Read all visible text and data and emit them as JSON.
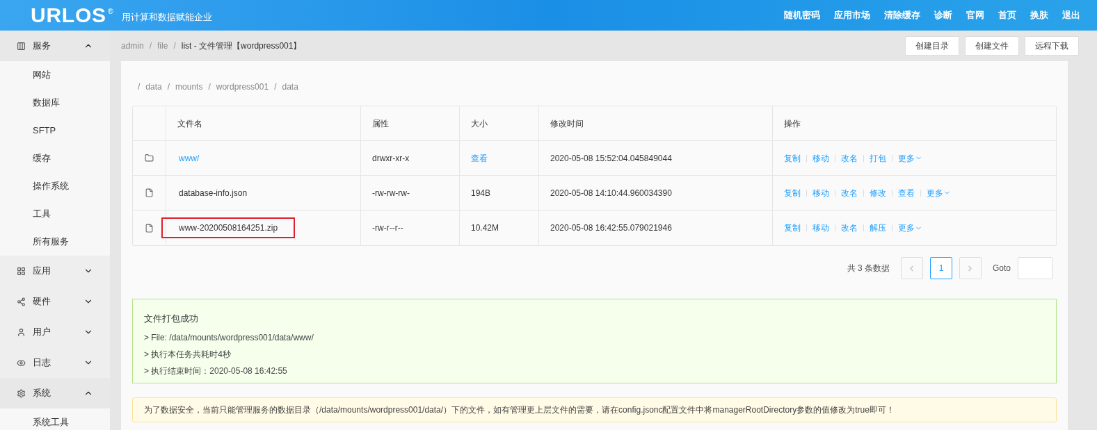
{
  "header": {
    "logo": "URLOS",
    "logo_mark": "®",
    "tagline": "用计算和数据赋能企业",
    "nav": [
      "随机密码",
      "应用市场",
      "清除缓存",
      "诊断",
      "官网",
      "首页",
      "换肤",
      "退出"
    ]
  },
  "sidebar": {
    "groups": [
      {
        "label": "服务",
        "expanded": true,
        "children": [
          {
            "label": "网站"
          },
          {
            "label": "数据库"
          },
          {
            "label": "SFTP"
          },
          {
            "label": "缓存"
          },
          {
            "label": "操作系统"
          },
          {
            "label": "工具"
          },
          {
            "label": "所有服务"
          }
        ]
      },
      {
        "label": "应用",
        "expanded": false
      },
      {
        "label": "硬件",
        "expanded": false
      },
      {
        "label": "用户",
        "expanded": false
      },
      {
        "label": "日志",
        "expanded": false
      },
      {
        "label": "系统",
        "expanded": true,
        "children": [
          {
            "label": "系统工具"
          }
        ]
      }
    ]
  },
  "breadcrumb_separator": "/",
  "breadcrumb": [
    "admin",
    "file",
    "list - 文件管理【wordpress001】"
  ],
  "toolbar": [
    "创建目录",
    "创建文件",
    "远程下载"
  ],
  "path_separator": "/",
  "path": [
    "data",
    "mounts",
    "wordpress001",
    "data"
  ],
  "table": {
    "columns": [
      "",
      "文件名",
      "属性",
      "大小",
      "修改时间",
      "操作"
    ],
    "rows": [
      {
        "kind": "folder",
        "name": "www/",
        "highlighted": false,
        "attributes": "drwxr-xr-x",
        "size": "查看",
        "size_link": true,
        "modified": "2020-05-08 15:52:04.045849044",
        "actions": [
          {
            "label": "复制",
            "kind": "link"
          },
          {
            "label": "移动",
            "kind": "link"
          },
          {
            "label": "改名",
            "kind": "link"
          },
          {
            "label": "打包",
            "kind": "link"
          },
          {
            "label": "更多",
            "kind": "dropdown"
          }
        ]
      },
      {
        "kind": "file",
        "name": "database-info.json",
        "highlighted": false,
        "attributes": "-rw-rw-rw-",
        "size": "194B",
        "size_link": false,
        "modified": "2020-05-08 14:10:44.960034390",
        "actions": [
          {
            "label": "复制",
            "kind": "link"
          },
          {
            "label": "移动",
            "kind": "link"
          },
          {
            "label": "改名",
            "kind": "link"
          },
          {
            "label": "修改",
            "kind": "link"
          },
          {
            "label": "查看",
            "kind": "link"
          },
          {
            "label": "更多",
            "kind": "dropdown"
          }
        ]
      },
      {
        "kind": "file",
        "name": "www-20200508164251.zip",
        "highlighted": true,
        "attributes": "-rw-r--r--",
        "size": "10.42M",
        "size_link": false,
        "modified": "2020-05-08 16:42:55.079021946",
        "actions": [
          {
            "label": "复制",
            "kind": "link"
          },
          {
            "label": "移动",
            "kind": "link"
          },
          {
            "label": "改名",
            "kind": "link"
          },
          {
            "label": "解压",
            "kind": "link"
          },
          {
            "label": "更多",
            "kind": "dropdown"
          }
        ]
      }
    ]
  },
  "pagination": {
    "total": "共 3 条数据",
    "pages": [
      {
        "label": "1",
        "selected": true
      }
    ],
    "goto_label": "Goto"
  },
  "success_alert": {
    "title": "文件打包成功",
    "lines": [
      "> File: /data/mounts/wordpress001/data/www/",
      "> 执行本任务共耗时4秒",
      "> 执行结束时间：2020-05-08 16:42:55"
    ]
  },
  "warning_alert": "为了数据安全，当前只能管理服务的数据目录（/data/mounts/wordpress001/data/）下的文件，如有管理更上层文件的需要，请在config.jsonc配置文件中将managerRootDirectory参数的值修改为true即可！"
}
